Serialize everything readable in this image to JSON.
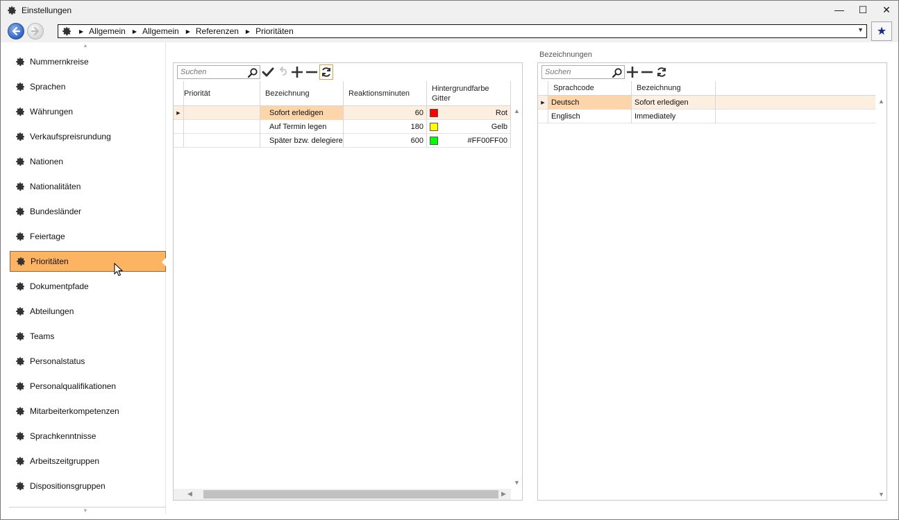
{
  "window": {
    "title": "Einstellungen",
    "controls": {
      "minimize": "—",
      "maximize": "☐",
      "close": "✕"
    }
  },
  "address": {
    "crumbs": [
      "Allgemein",
      "Allgemein",
      "Referenzen",
      "Prioritäten"
    ],
    "dropdown_glyph": "▼",
    "favorite_glyph": "★"
  },
  "sidebar": {
    "items": [
      "Nummernkreise",
      "Sprachen",
      "Währungen",
      "Verkaufspreisrundung",
      "Nationen",
      "Nationalitäten",
      "Bundesländer",
      "Feiertage",
      "Prioritäten",
      "Dokumentpfade",
      "Abteilungen",
      "Teams",
      "Personalstatus",
      "Personalqualifikationen",
      "Mitarbeiterkompetenzen",
      "Sprachkenntnisse",
      "Arbeitszeitgruppen",
      "Dispositionsgruppen"
    ],
    "active_index": 8
  },
  "priorities": {
    "search_placeholder": "Suchen",
    "columns": [
      "Priorität",
      "Bezeichnung",
      "Reaktionsminuten",
      "Hintergrundfarbe Gitter"
    ],
    "rows": [
      {
        "prioritaet": "",
        "bezeichnung": "Sofort erledigen",
        "minuten": "60",
        "farbe_name": "Rot",
        "farbe_hex": "#ff0000"
      },
      {
        "prioritaet": "",
        "bezeichnung": "Auf Termin legen",
        "minuten": "180",
        "farbe_name": "Gelb",
        "farbe_hex": "#ffff00"
      },
      {
        "prioritaet": "",
        "bezeichnung": "Später bzw. delegieren",
        "minuten": "600",
        "farbe_name": "#FF00FF00",
        "farbe_hex": "#00ff00"
      }
    ],
    "selected_row": 0
  },
  "labels": {
    "title": "Bezeichnungen",
    "search_placeholder": "Suchen",
    "columns": [
      "Sprachcode",
      "Bezeichnung"
    ],
    "rows": [
      {
        "sprachcode": "Deutsch",
        "bezeichnung": "Sofort erledigen"
      },
      {
        "sprachcode": "Englisch",
        "bezeichnung": "Immediately"
      }
    ],
    "selected_row": 0
  },
  "colors": {
    "selection": "#fdb462",
    "row_highlight": "#fcd5aa",
    "accent": "#2d64c8"
  }
}
